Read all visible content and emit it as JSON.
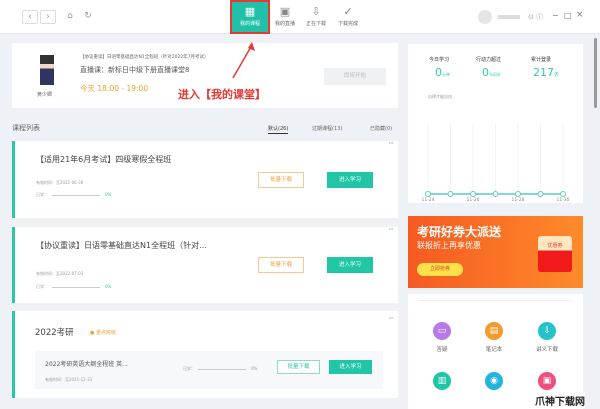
{
  "topbar": {
    "back": "‹",
    "forward": "›",
    "home": "⌂",
    "refresh": "↻",
    "tabs": [
      {
        "label": "我的课程",
        "icon": "grid-icon",
        "glyph": "▦",
        "active": true
      },
      {
        "label": "我的直播",
        "icon": "live-icon",
        "glyph": "▣"
      },
      {
        "label": "正在下载",
        "icon": "download-icon",
        "glyph": "⇩"
      },
      {
        "label": "下载完成",
        "icon": "check-icon",
        "glyph": "✓"
      }
    ],
    "window": {
      "minimize": "−",
      "maximize": "□",
      "close": "×"
    }
  },
  "live": {
    "teacher": "黄少卿",
    "course": "【协议重读】日语零基础直达N1全程班（针对2022年7月考试）",
    "title": "直播课：新标日中级下册直播课堂8",
    "time": "今天 18:00 - 19:00",
    "button": "即将开始"
  },
  "annotation": "进入【我的课堂】",
  "list": {
    "title": "课程列表",
    "tabs": [
      "默认(26)",
      "过期课程(13)",
      "已隐藏(0)"
    ]
  },
  "courses": [
    {
      "title": "【适用21年6月考试】四级寒假全程班",
      "validity": "有效时间：至2021-06-30",
      "progress_label": "已学：",
      "progress": "0%",
      "download": "批量下载",
      "enter": "进入学习"
    },
    {
      "title": "【协议重读】日语零基础直达N1全程班（针对...",
      "validity": "有效时间：至2022-07-03",
      "progress_label": "已学：",
      "progress": "0%",
      "download": "批量下载",
      "enter": "进入学习"
    }
  ],
  "group": {
    "title": "2022考研",
    "badge": "重点班级",
    "item": {
      "title": "2022考研英语大纲全程班 英...",
      "validity": "有效时间：至2021-12-31",
      "progress_label": "已学：",
      "progress": "0%",
      "download": "批量下载",
      "enter": "进入学习"
    }
  },
  "stats": {
    "items": [
      {
        "label": "今日学习",
        "value": "0",
        "unit": "分钟"
      },
      {
        "label": "行动力超过",
        "value": "0",
        "unit": "%同学"
      },
      {
        "label": "累计登录",
        "value": "217",
        "unit": "天"
      }
    ],
    "legend": "自律才能自由"
  },
  "chart_data": {
    "type": "line",
    "x": [
      "11-24",
      "11-25",
      "11-26",
      "11-27",
      "11-28",
      "11-29",
      "11-30"
    ],
    "tick_labels": [
      "11-24",
      "11-26",
      "11-28",
      "11-30"
    ],
    "values": [
      0,
      0,
      0,
      0,
      0,
      0,
      0
    ],
    "color": "#5ccdb8"
  },
  "banner": {
    "title": "考研好券大派送",
    "subtitle": "联报折上再享优惠",
    "button": "立即抢券",
    "coupon": "优惠券"
  },
  "tools": [
    {
      "label": "答疑",
      "color": "#b77be8",
      "glyph": "▭"
    },
    {
      "label": "笔记本",
      "color": "#f39a2b",
      "glyph": "▤"
    },
    {
      "label": "讲义下载",
      "color": "#26c2c9",
      "glyph": "⇩"
    },
    {
      "color": "#20c6a6",
      "glyph": "▥"
    },
    {
      "color": "#23b4e0",
      "glyph": "◉"
    },
    {
      "color": "#ef4f7d",
      "glyph": "▣"
    }
  ],
  "watermark": "爪神下载网"
}
